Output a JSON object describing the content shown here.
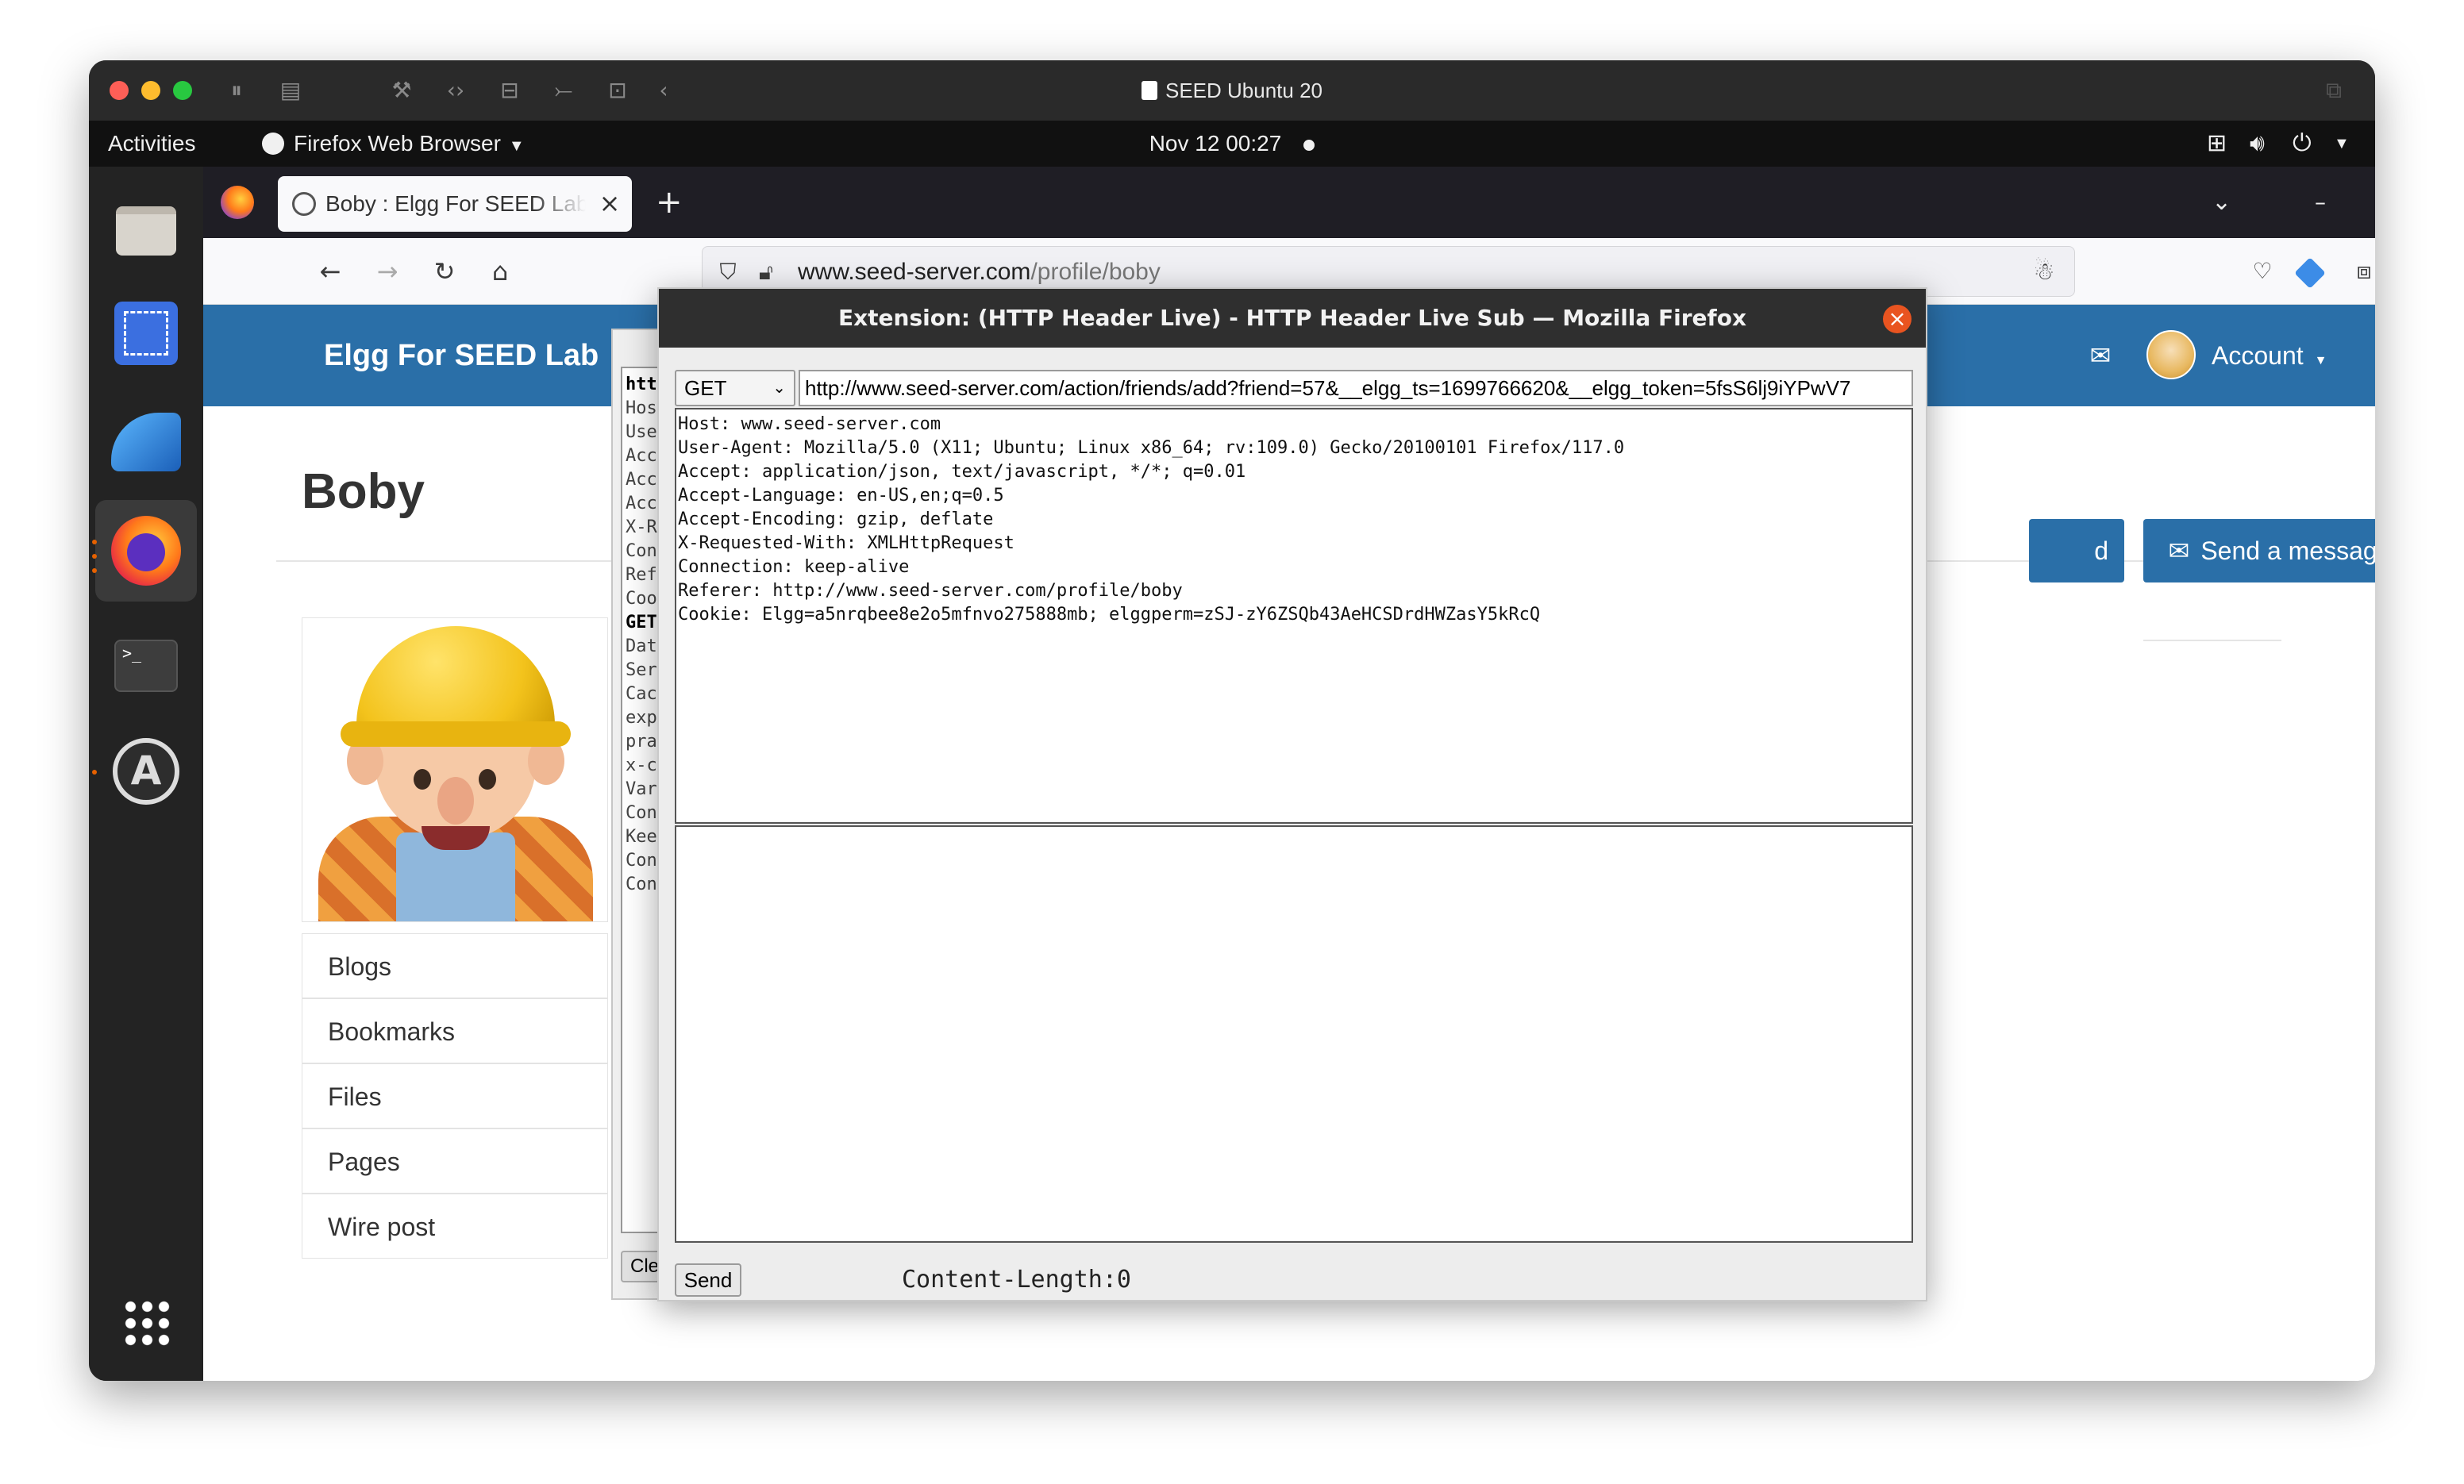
{
  "vm": {
    "title": "SEED Ubuntu 20",
    "traffic_colors": [
      "#fe5f57",
      "#febc2e",
      "#28c840"
    ]
  },
  "topbar": {
    "activities": "Activities",
    "app_menu": "Firefox Web Browser",
    "clock": "Nov 12  00:27"
  },
  "browser": {
    "tab_title": "Boby : Elgg For SEED Lab",
    "url_domain": "www.seed-server.com",
    "url_path": "/profile/boby"
  },
  "elgg": {
    "site_name": "Elgg For SEED Lab",
    "account_label": "Account",
    "profile_name": "Boby",
    "send_message_label": "Send a message",
    "add_friend_partial": "d",
    "menu": [
      "Blogs",
      "Bookmarks",
      "Files",
      "Pages",
      "Wire post"
    ],
    "colors": {
      "header": "#2a6fa8",
      "button": "#2a6fa8"
    }
  },
  "behind_panel": {
    "lines": [
      "htt",
      "Hos",
      "Use",
      "Acc",
      "Acc",
      "Acc",
      "X-R",
      "Con",
      "Ref",
      "Coo",
      "GET",
      "Dat",
      "Ser",
      "Cac",
      "exp",
      "pra",
      "x-c",
      "Var",
      "Con",
      "Kee",
      "Con",
      "Con"
    ],
    "clear_label": "Cle"
  },
  "extension": {
    "title": "Extension: (HTTP Header Live) - HTTP Header Live Sub — Mozilla Firefox",
    "method": "GET",
    "url": "http://www.seed-server.com/action/friends/add?friend=57&__elgg_ts=1699766620&__elgg_token=5fsS6lj9iYPwV7",
    "headers": [
      "Host: www.seed-server.com",
      "User-Agent: Mozilla/5.0 (X11; Ubuntu; Linux x86_64; rv:109.0) Gecko/20100101 Firefox/117.0",
      "Accept: application/json, text/javascript, */*; q=0.01",
      "Accept-Language: en-US,en;q=0.5",
      "Accept-Encoding: gzip, deflate",
      "X-Requested-With: XMLHttpRequest",
      "Connection: keep-alive",
      "Referer: http://www.seed-server.com/profile/boby",
      "Cookie: Elgg=a5nrqbee8e2o5mfnvo275888mb; elggperm=zSJ-zY6ZSQb43AeHCSDrdHWZasY5kRcQ"
    ],
    "body": "",
    "send_label": "Send",
    "content_length": "Content-Length:0"
  }
}
